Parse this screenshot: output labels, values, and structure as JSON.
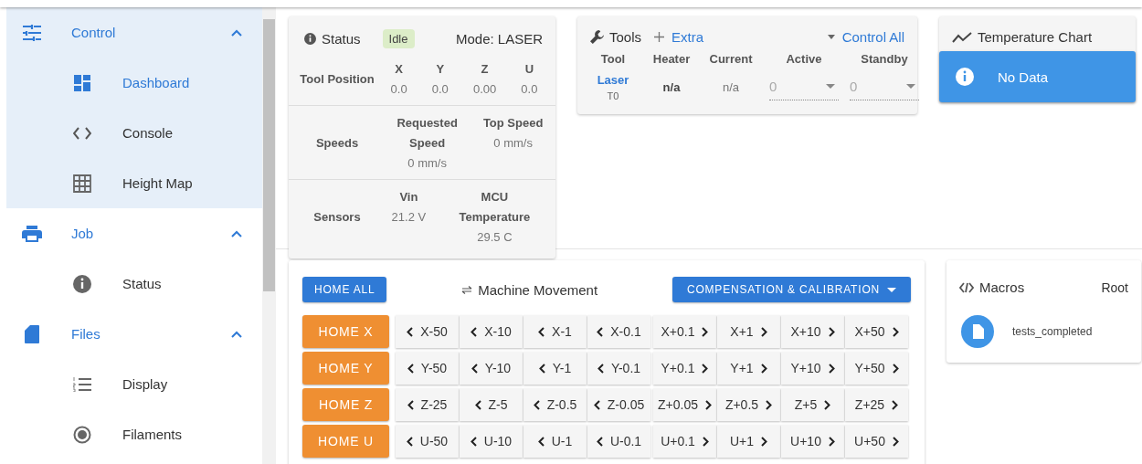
{
  "sidebar": {
    "groups": [
      {
        "label": "Control",
        "expanded": true,
        "children": [
          {
            "label": "Dashboard",
            "selected": true
          },
          {
            "label": "Console",
            "selected": false
          },
          {
            "label": "Height Map",
            "selected": false
          }
        ]
      },
      {
        "label": "Job",
        "expanded": true,
        "children": [
          {
            "label": "Status",
            "selected": false
          }
        ]
      },
      {
        "label": "Files",
        "expanded": true,
        "children": [
          {
            "label": "Display",
            "selected": false
          },
          {
            "label": "Filaments",
            "selected": false
          }
        ]
      }
    ]
  },
  "status": {
    "title": "Status",
    "state": "Idle",
    "mode": "Mode: LASER",
    "sections": [
      {
        "label": "Tool Position",
        "columns": [
          {
            "name": "X",
            "value": "0.0"
          },
          {
            "name": "Y",
            "value": "0.0"
          },
          {
            "name": "Z",
            "value": "0.00"
          },
          {
            "name": "U",
            "value": "0.0"
          }
        ]
      },
      {
        "label": "Speeds",
        "columns": [
          {
            "name": "Requested Speed",
            "value": "0 mm/s"
          },
          {
            "name": "Top Speed",
            "value": "0 mm/s"
          }
        ]
      },
      {
        "label": "Sensors",
        "columns": [
          {
            "name": "Vin",
            "value": "21.2 V"
          },
          {
            "name": "MCU Temperature",
            "value": "29.5 C"
          }
        ]
      }
    ]
  },
  "tools": {
    "title": "Tools",
    "extra": "Extra",
    "control_all": "Control All",
    "columns": [
      "Tool",
      "Heater",
      "Current",
      "Active",
      "Standby"
    ],
    "rows": [
      {
        "tool": "Laser",
        "number": "T0",
        "heater": "n/a",
        "current": "n/a",
        "active": "0",
        "standby": "0"
      }
    ]
  },
  "temperature_chart": {
    "title": "Temperature Chart",
    "alert": "No Data"
  },
  "movement": {
    "home_all": "HOME ALL",
    "title": "Machine Movement",
    "compensation": "COMPENSATION & CALIBRATION",
    "axes": [
      {
        "home": "HOME X",
        "decrease": [
          "X-50",
          "X-10",
          "X-1",
          "X-0.1"
        ],
        "increase": [
          "X+0.1",
          "X+1",
          "X+10",
          "X+50"
        ]
      },
      {
        "home": "HOME Y",
        "decrease": [
          "Y-50",
          "Y-10",
          "Y-1",
          "Y-0.1"
        ],
        "increase": [
          "Y+0.1",
          "Y+1",
          "Y+10",
          "Y+50"
        ]
      },
      {
        "home": "HOME Z",
        "decrease": [
          "Z-25",
          "Z-5",
          "Z-0.5",
          "Z-0.05"
        ],
        "increase": [
          "Z+0.05",
          "Z+0.5",
          "Z+5",
          "Z+25"
        ]
      },
      {
        "home": "HOME U",
        "decrease": [
          "U-50",
          "U-10",
          "U-1",
          "U-0.1"
        ],
        "increase": [
          "U+0.1",
          "U+1",
          "U+10",
          "U+50"
        ]
      }
    ]
  },
  "macros": {
    "title": "Macros",
    "folder": "Root",
    "items": [
      {
        "name": "tests_completed"
      }
    ]
  }
}
